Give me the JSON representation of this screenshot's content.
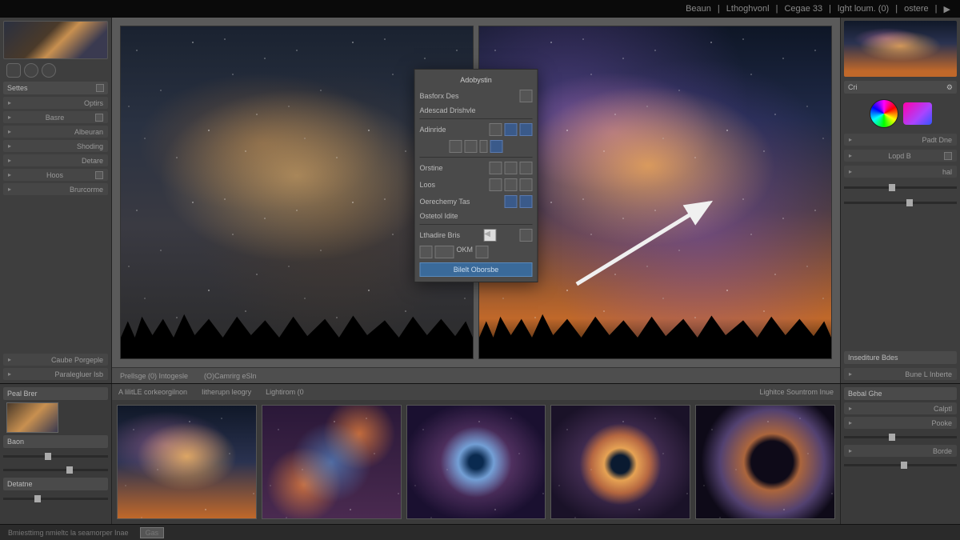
{
  "topbar": {
    "items": [
      "Beaun",
      "Lthoghvonl",
      "Cegae 33",
      "lght loum. (0)",
      "ostere"
    ]
  },
  "left": {
    "section1": "Settes",
    "items": [
      "Optirs",
      "Basre",
      "Albeuran",
      "Shoding",
      "Detare",
      "Hoos",
      "Brurcorme",
      "Caube Porgeple",
      "Paralegluer Isb"
    ]
  },
  "dialog": {
    "title": "Adobystin",
    "row1": "Basforx Des",
    "row2": "Adescad Drishvle",
    "row3": "Adinride",
    "row4": "Orstine",
    "row5": "Loos",
    "row6": "Oerechemy Tas",
    "row7": "Ostetol Idite",
    "row8": "Lthadire Bris",
    "footer": "OKM",
    "button": "Bilelt Oborsbe"
  },
  "center_bar": {
    "left": "Prellsge (0) Intogesle",
    "mid": "(O)Camrirg eSln"
  },
  "right": {
    "head1": "Cri",
    "item1": "Padt Dne",
    "item2": "Lopd B",
    "item3": "hal",
    "sec2": "Insediture Bdes",
    "sec2b": "Bune L Inberte"
  },
  "film_head": {
    "a": "A lilitLE corkeorgilnon",
    "b": "Iitherupn leogry",
    "c": "Lightirom (0",
    "d": "Lighitce Sountrom Inue"
  },
  "bottom_left": {
    "h1": "Peal Brer",
    "h2": "Baon",
    "h3": "Detatne"
  },
  "bottom_right": {
    "h1": "Bebal Ghe",
    "items": [
      "Calptl",
      "Pooke",
      "Borde"
    ]
  },
  "status": {
    "text": "Bmiesttimg nmieltc la seamorper Inae",
    "btn": "Gas"
  }
}
